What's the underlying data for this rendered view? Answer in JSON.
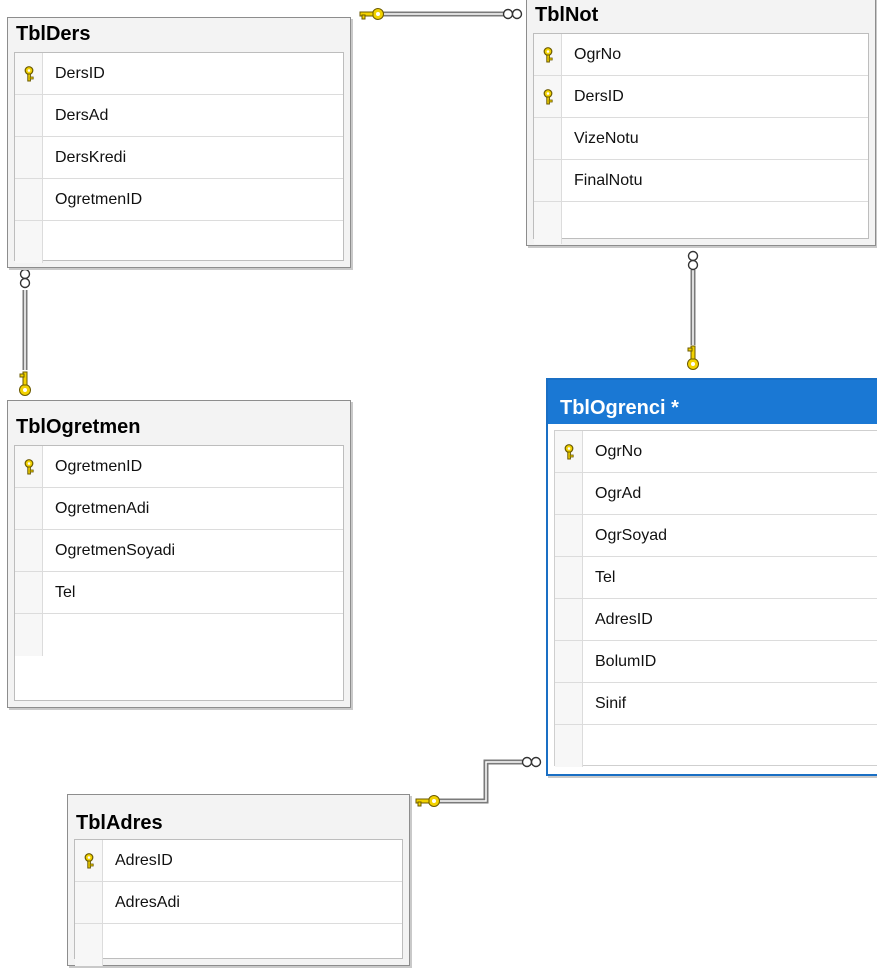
{
  "colors": {
    "active_header": "#1a78d4",
    "key_yellow": "#f2d200",
    "connector": "#7a7a7a"
  },
  "icons": {
    "primary_key": "key-icon",
    "one_end": "key-endpoint-icon",
    "many_end": "infinity-endpoint-icon"
  },
  "tables": {
    "ders": {
      "title": "TblDers",
      "columns": [
        {
          "name": "DersID",
          "pk": true
        },
        {
          "name": "DersAd",
          "pk": false
        },
        {
          "name": "DersKredi",
          "pk": false
        },
        {
          "name": "OgretmenID",
          "pk": false
        }
      ]
    },
    "not": {
      "title": "TblNot",
      "columns": [
        {
          "name": "OgrNo",
          "pk": true
        },
        {
          "name": "DersID",
          "pk": true
        },
        {
          "name": "VizeNotu",
          "pk": false
        },
        {
          "name": "FinalNotu",
          "pk": false
        }
      ]
    },
    "ogretmen": {
      "title": "TblOgretmen",
      "columns": [
        {
          "name": "OgretmenID",
          "pk": true
        },
        {
          "name": "OgretmenAdi",
          "pk": false
        },
        {
          "name": "OgretmenSoyadi",
          "pk": false
        },
        {
          "name": "Tel",
          "pk": false
        }
      ]
    },
    "ogrenci": {
      "title": "TblOgrenci *",
      "columns": [
        {
          "name": "OgrNo",
          "pk": true
        },
        {
          "name": "OgrAd",
          "pk": false
        },
        {
          "name": "OgrSoyad",
          "pk": false
        },
        {
          "name": "Tel",
          "pk": false
        },
        {
          "name": "AdresID",
          "pk": false
        },
        {
          "name": "BolumID",
          "pk": false
        },
        {
          "name": "Sinif",
          "pk": false
        }
      ]
    },
    "adres": {
      "title": "TblAdres",
      "columns": [
        {
          "name": "AdresID",
          "pk": true
        },
        {
          "name": "AdresAdi",
          "pk": false
        }
      ]
    }
  }
}
